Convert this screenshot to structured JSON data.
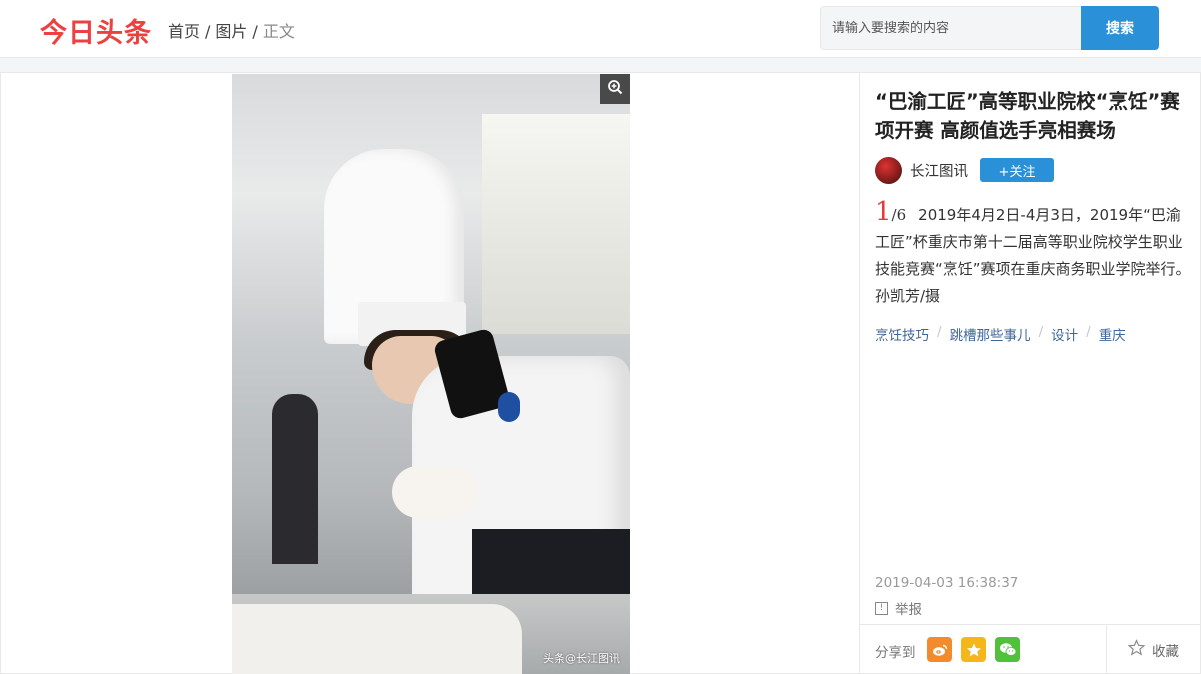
{
  "header": {
    "logo": "今日头条",
    "breadcrumb": {
      "home": "首页",
      "category": "图片",
      "current": "正文",
      "separator": "/"
    },
    "search": {
      "placeholder": "请输入要搜索的内容",
      "button_label": "搜索"
    }
  },
  "colors": {
    "brand_red": "#ed4040",
    "accent_blue": "#2a90d7",
    "tag_blue": "#406599"
  },
  "viewer": {
    "watermark": "头条@长江图讯",
    "zoom_icon": "zoom-in-icon"
  },
  "article": {
    "title": "“巴渝工匠”高等职业院校“烹饪”赛项开赛 高颜值选手亮相赛场",
    "author": {
      "name": "长江图讯",
      "follow_label": "+关注"
    },
    "gallery": {
      "current": "1",
      "total": "/6"
    },
    "caption": "2019年4月2日-4月3日，2019年“巴渝工匠”杯重庆市第十二届高等职业院校学生职业技能竞赛“烹饪”赛项在重庆商务职业学院举行。孙凯芳/摄",
    "tags": [
      "烹饪技巧",
      "跳槽那些事儿",
      "设计",
      "重庆"
    ],
    "tag_separator": "/",
    "publish_time": "2019-04-03 16:38:37",
    "report_label": "举报",
    "report_icon": "!"
  },
  "share": {
    "label": "分享到",
    "icons": [
      "weibo-icon",
      "qzone-icon",
      "wechat-icon"
    ],
    "favorite_label": "收藏"
  }
}
